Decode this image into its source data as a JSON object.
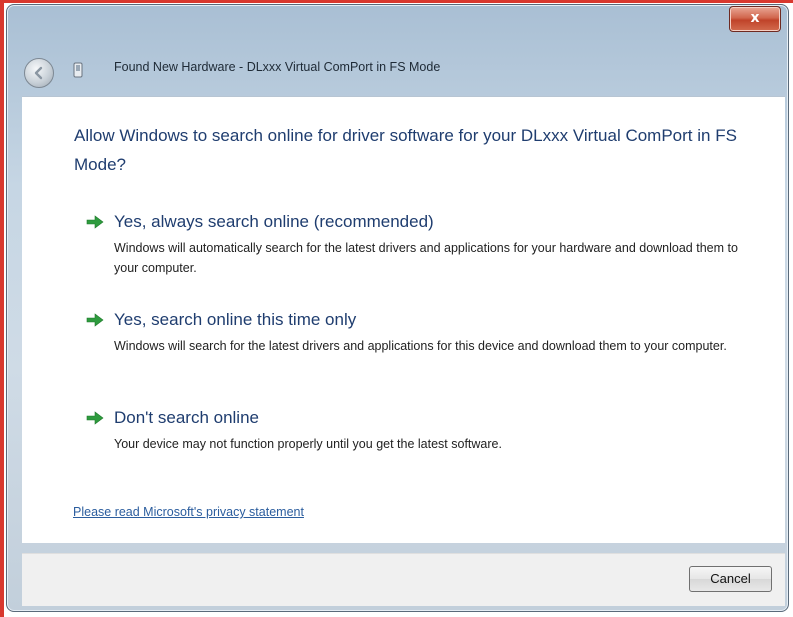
{
  "window": {
    "title": "Found New Hardware - DLxxx Virtual ComPort in FS Mode",
    "close_label": "x"
  },
  "main": {
    "question": "Allow Windows to search online for driver software for your DLxxx Virtual ComPort in FS Mode?",
    "options": [
      {
        "title": "Yes, always search online (recommended)",
        "description": "Windows will automatically search for the latest drivers and applications for your hardware and download them to your computer.",
        "icon": "green-arrow-icon"
      },
      {
        "title": "Yes, search online this time only",
        "description": "Windows will search for the latest drivers and applications for this device and download them to your computer.",
        "icon": "green-arrow-icon"
      },
      {
        "title": "Don't search online",
        "description": "Your device may not function properly until you get the latest software.",
        "icon": "green-arrow-icon"
      }
    ],
    "privacy_link": "Please read Microsoft's privacy statement"
  },
  "footer": {
    "cancel_label": "Cancel"
  },
  "colors": {
    "heading": "#1f3d6f",
    "link": "#2b5d9e",
    "arrow": "#2e9b3e",
    "close": "#c0432a"
  }
}
